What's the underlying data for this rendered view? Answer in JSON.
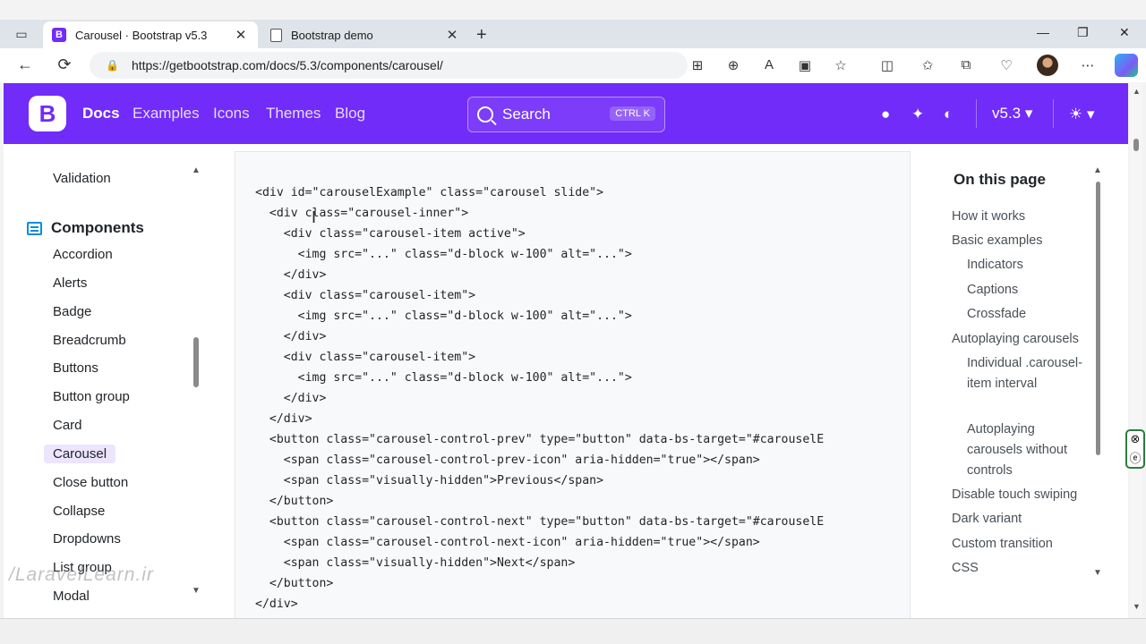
{
  "browser": {
    "tabs": [
      {
        "title": "Carousel · Bootstrap v5.3",
        "favicon": "B",
        "active": true
      },
      {
        "title": "Bootstrap demo",
        "active": false
      }
    ],
    "url": "https://getbootstrap.com/docs/5.3/components/carousel/",
    "icons": {
      "back": "←",
      "reload": "⟳",
      "lock": "🔒",
      "newtab": "+",
      "minimize": "—",
      "restore": "❐",
      "close": "✕",
      "apps": "⊞",
      "zoom": "⊕",
      "read": "A",
      "immersive": "▣",
      "favorite": "☆",
      "split": "◫",
      "favorites": "✩",
      "collections": "⧉",
      "performance": "♡",
      "more": "⋯"
    }
  },
  "site": {
    "logo": "B",
    "nav": [
      "Docs",
      "Examples",
      "Icons",
      "Themes",
      "Blog"
    ],
    "search": {
      "label": "Search",
      "shortcut": "CTRL K"
    },
    "version": "v5.3",
    "icons": {
      "github": "●",
      "twitter": "✦",
      "opencollective": "◐",
      "theme": "☀",
      "caret": "▾"
    }
  },
  "sidebar": {
    "above": "Validation",
    "section": "Components",
    "items": [
      "Accordion",
      "Alerts",
      "Badge",
      "Breadcrumb",
      "Buttons",
      "Button group",
      "Card",
      "Carousel",
      "Close button",
      "Collapse",
      "Dropdowns",
      "List group",
      "Modal"
    ],
    "active": "Carousel",
    "watermark": "/LaravelLearn.ir"
  },
  "code_lines": [
    "<div id=\"carouselExample\" class=\"carousel slide\">",
    "  <div class=\"carousel-inner\">",
    "    <div class=\"carousel-item active\">",
    "      <img src=\"...\" class=\"d-block w-100\" alt=\"...\">",
    "    </div>",
    "    <div class=\"carousel-item\">",
    "      <img src=\"...\" class=\"d-block w-100\" alt=\"...\">",
    "    </div>",
    "    <div class=\"carousel-item\">",
    "      <img src=\"...\" class=\"d-block w-100\" alt=\"...\">",
    "    </div>",
    "  </div>",
    "  <button class=\"carousel-control-prev\" type=\"button\" data-bs-target=\"#carouselE",
    "    <span class=\"carousel-control-prev-icon\" aria-hidden=\"true\"></span>",
    "    <span class=\"visually-hidden\">Previous</span>",
    "  </button>",
    "  <button class=\"carousel-control-next\" type=\"button\" data-bs-target=\"#carouselE",
    "    <span class=\"carousel-control-next-icon\" aria-hidden=\"true\"></span>",
    "    <span class=\"visually-hidden\">Next</span>",
    "  </button>",
    "</div>"
  ],
  "toc": {
    "title": "On this page",
    "items": [
      {
        "label": "How it works",
        "level": 1
      },
      {
        "label": "Basic examples",
        "level": 1
      },
      {
        "label": "Indicators",
        "level": 2
      },
      {
        "label": "Captions",
        "level": 2
      },
      {
        "label": "Crossfade",
        "level": 2
      },
      {
        "label": "Autoplaying carousels",
        "level": 1
      },
      {
        "label": "Individual .carousel-item interval",
        "level": 2
      },
      {
        "label": "Autoplaying carousels without controls",
        "level": 2
      },
      {
        "label": "Disable touch swiping",
        "level": 1
      },
      {
        "label": "Dark variant",
        "level": 1
      },
      {
        "label": "Custom transition",
        "level": 1
      },
      {
        "label": "CSS",
        "level": 1
      }
    ]
  }
}
